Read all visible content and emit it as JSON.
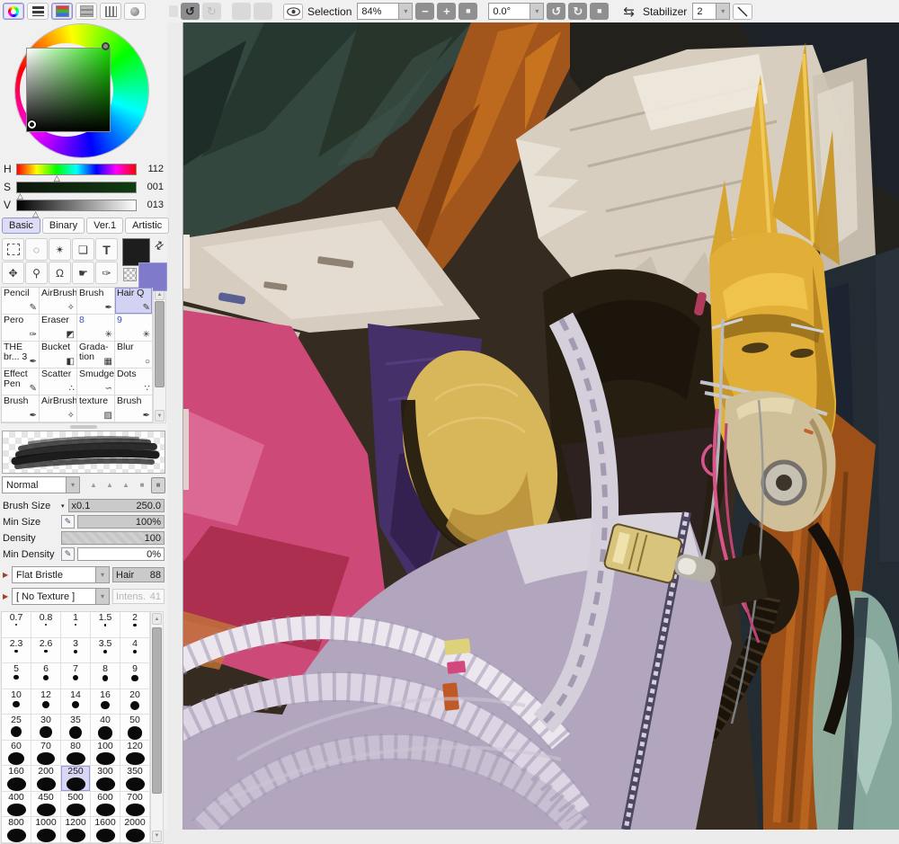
{
  "toolbar": {
    "selection_label": "Selection",
    "zoom_value": "84%",
    "angle_value": "0.0°",
    "stabilizer_label": "Stabilizer",
    "stabilizer_value": "2"
  },
  "icons": {
    "undo": "↺",
    "redo": "↻",
    "minus": "−",
    "plus": "+",
    "zoom_reset": "■",
    "rotate_ccw": "↺",
    "rotate_cw": "↻",
    "angle_reset": "■",
    "flip": "⇆",
    "dropdown": "▾",
    "scroll_up": "▲",
    "scroll_down": "▼",
    "swap": "⇄",
    "size_dropdown": "▾",
    "pressure": "✎"
  },
  "color_panel": {
    "h_label": "H",
    "h_value": "112",
    "s_label": "S",
    "s_value": "001",
    "v_label": "V",
    "v_value": "013"
  },
  "tabs": {
    "items": [
      "Basic",
      "Binary",
      "Ver.1",
      "Artistic"
    ],
    "active": "Basic"
  },
  "tools": {
    "lasso": "◌",
    "wand": "✴",
    "shapes": "❏",
    "text": "T",
    "move": "✥",
    "zoom": "⚲",
    "rotate": "Ω",
    "hand": "☛",
    "eyedropper": "✑"
  },
  "presets": {
    "items": [
      {
        "label": "Pencil",
        "icon": "✎"
      },
      {
        "label": "AirBrush",
        "icon": "✧"
      },
      {
        "label": "Brush",
        "icon": "✒"
      },
      {
        "label": "Hair Q",
        "icon": "✎",
        "selected": true
      },
      {
        "label": "Pero",
        "icon": "✑"
      },
      {
        "label": "Eraser",
        "icon": "◩"
      },
      {
        "label": "8",
        "icon": "✳",
        "accent": true
      },
      {
        "label": "9",
        "icon": "✳",
        "accent": true
      },
      {
        "label": "THE br... 3",
        "icon": "✒"
      },
      {
        "label": "Bucket",
        "icon": "◧"
      },
      {
        "label": "Grada-tion",
        "icon": "▦"
      },
      {
        "label": "Blur",
        "icon": "○"
      },
      {
        "label": "Effect Pen",
        "icon": "✎"
      },
      {
        "label": "Scatter",
        "icon": "∴"
      },
      {
        "label": "Smudge",
        "icon": "∽"
      },
      {
        "label": "Dots",
        "icon": "∵"
      },
      {
        "label": "Brush",
        "icon": "✒"
      },
      {
        "label": "AirBrush",
        "icon": "✧"
      },
      {
        "label": "texture",
        "icon": "▨"
      },
      {
        "label": "Brush",
        "icon": "✒"
      }
    ]
  },
  "blend": {
    "mode": "Normal",
    "shape_buttons": [
      "▲",
      "▲",
      "▲",
      "■",
      "■"
    ],
    "selected_shape": 4
  },
  "settings": {
    "brush_size_label": "Brush Size",
    "brush_size_mult": "x0.1",
    "brush_size_value": "250.0",
    "min_size_label": "Min Size",
    "min_size_value": "100%",
    "density_label": "Density",
    "density_value": "100",
    "min_density_label": "Min Density",
    "min_density_value": "0%",
    "bristle_type": "Flat Bristle",
    "hair_label": "Hair",
    "hair_value": "88",
    "texture_name": "[ No Texture ]",
    "intensity_label": "Intens.",
    "intensity_value": "41"
  },
  "size_grid": {
    "values": [
      "0.7",
      "0.8",
      "1",
      "1.5",
      "2",
      "2.3",
      "2.6",
      "3",
      "3.5",
      "4",
      "5",
      "6",
      "7",
      "8",
      "9",
      "10",
      "12",
      "14",
      "16",
      "20",
      "25",
      "30",
      "35",
      "40",
      "50",
      "60",
      "70",
      "80",
      "100",
      "120",
      "160",
      "200",
      "250",
      "300",
      "350",
      "400",
      "450",
      "500",
      "600",
      "700",
      "800",
      "1000",
      "1200",
      "1600",
      "2000"
    ],
    "selected": "250"
  },
  "canvas": {
    "palette": [
      "#33473f",
      "#a2561c",
      "#d7cec0",
      "#e1ae37",
      "#cfc09a",
      "#cd4a78",
      "#463069",
      "#d8b65a",
      "#b1a6bd",
      "#232c33",
      "#9c5018",
      "#8fb3a6"
    ]
  }
}
